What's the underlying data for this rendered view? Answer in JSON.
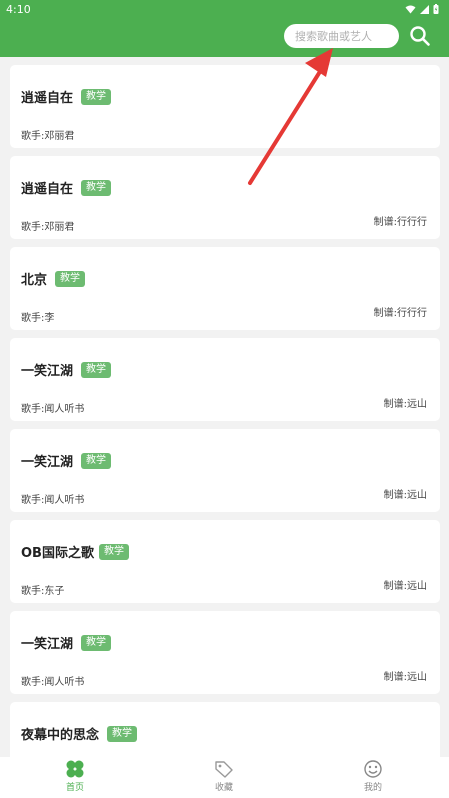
{
  "status": {
    "time": "4:10"
  },
  "search": {
    "placeholder": "搜索歌曲或艺人"
  },
  "songs": [
    {
      "title": "逍遥自在",
      "tag": "教学",
      "singer": "歌手:邓丽君",
      "maker": ""
    },
    {
      "title": "逍遥自在",
      "tag": "教学",
      "singer": "歌手:邓丽君",
      "maker": "制谱:行行行"
    },
    {
      "title": "北京",
      "tag": "教学",
      "singer": "歌手:李",
      "maker": "制谱:行行行"
    },
    {
      "title": "一笑江湖",
      "tag": "教学",
      "singer": "歌手:闻人听书",
      "maker": "制谱:远山"
    },
    {
      "title": "一笑江湖",
      "tag": "教学",
      "singer": "歌手:闻人听书",
      "maker": "制谱:远山"
    },
    {
      "title": "OB国际之歌",
      "tag": "教学",
      "singer": "歌手:东子",
      "maker": "制谱:远山"
    },
    {
      "title": "一笑江湖",
      "tag": "教学",
      "singer": "歌手:闻人听书",
      "maker": "制谱:远山"
    },
    {
      "title": "夜幕中的思念",
      "tag": "教学",
      "singer": "",
      "maker": ""
    }
  ],
  "tabs": [
    {
      "label": "首页",
      "icon": "clover-icon",
      "active": true
    },
    {
      "label": "收藏",
      "icon": "tag-icon",
      "active": false
    },
    {
      "label": "我的",
      "icon": "smiley-icon",
      "active": false
    }
  ],
  "colors": {
    "brand": "#4caf50",
    "tag": "#6dbb71",
    "arrow": "#e53935"
  }
}
